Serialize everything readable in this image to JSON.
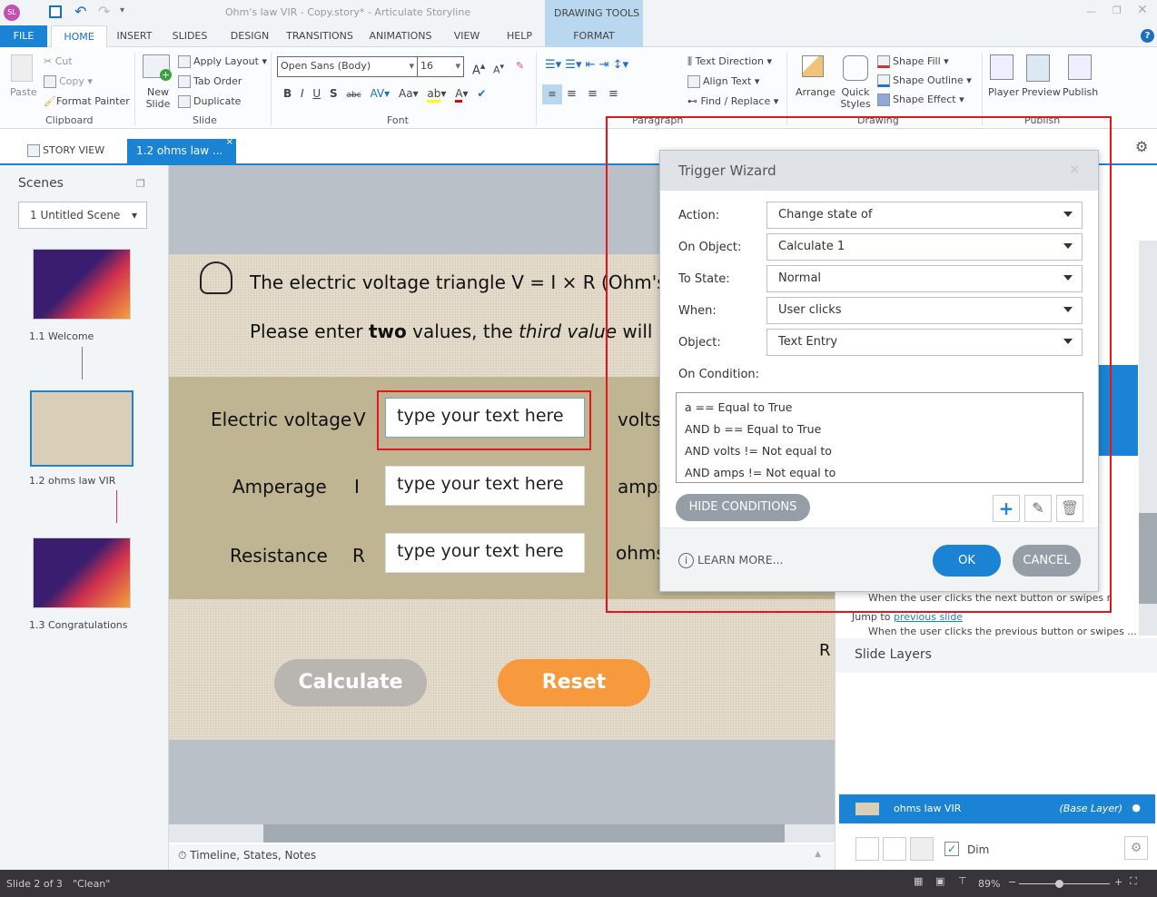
{
  "window": {
    "title": "Ohm's law VIR - Copy.story* -  Articulate Storyline",
    "app_badge": "SL",
    "context_tab_group": "DRAWING TOOLS"
  },
  "ribbon_tabs": [
    "FILE",
    "HOME",
    "INSERT",
    "SLIDES",
    "DESIGN",
    "TRANSITIONS",
    "ANIMATIONS",
    "VIEW",
    "HELP",
    "FORMAT"
  ],
  "ribbon": {
    "clipboard": {
      "paste": "Paste",
      "cut": "Cut",
      "copy": "Copy",
      "format_painter": "Format Painter",
      "label": "Clipboard"
    },
    "slide": {
      "new_slide": "New Slide",
      "apply_layout": "Apply Layout",
      "tab_order": "Tab Order",
      "duplicate": "Duplicate",
      "label": "Slide"
    },
    "font": {
      "family": "Open Sans (Body)",
      "size": "16",
      "label": "Font"
    },
    "paragraph": {
      "text_direction": "Text Direction",
      "align_text": "Align Text",
      "find_replace": "Find / Replace",
      "label": "Paragraph"
    },
    "drawing": {
      "arrange": "Arrange",
      "quick_styles": "Quick Styles",
      "shape_fill": "Shape Fill",
      "shape_outline": "Shape Outline",
      "shape_effect": "Shape Effect",
      "label": "Drawing"
    },
    "publish": {
      "player": "Player",
      "preview": "Preview",
      "publish": "Publish",
      "label": "Publish"
    }
  },
  "doc_tabs": {
    "story_view": "STORY VIEW",
    "active": "1.2 ohms law ..."
  },
  "scenes": {
    "title": "Scenes",
    "selected_scene": "1 Untitled Scene",
    "slides": [
      {
        "label": "1.1 Welcome"
      },
      {
        "label": "1.2 ohms law VIR"
      },
      {
        "label": "1.3 Congratulations"
      }
    ]
  },
  "slide": {
    "heading": "The electric voltage triangle V = I × R (Ohm's",
    "instr_pre": "Please enter ",
    "instr_bold": "two",
    "instr_mid": " values, the ",
    "instr_italic": "third value",
    "instr_post": " will be",
    "rows": [
      {
        "label": "Electric voltage",
        "symbol": "V",
        "placeholder": "type your text here",
        "unit": "volts"
      },
      {
        "label": "Amperage",
        "symbol": "I",
        "placeholder": "type your text here",
        "unit": "amps"
      },
      {
        "label": "Resistance",
        "symbol": "R",
        "placeholder": "type your text here",
        "unit": "ohms"
      }
    ],
    "stray_r": "R",
    "calculate": "Calculate",
    "reset": "Reset",
    "colors": {
      "calculate": "#b9b5b0",
      "reset": "#f79a3e"
    }
  },
  "timeline_bar": "Timeline, States, Notes",
  "triggers": {
    "line1": "When the user clicks the next button or swipes next",
    "jump_to": "Jump to ",
    "previous_slide": "previous slide",
    "line2": "When the user clicks the previous button or swipes ..."
  },
  "layers": {
    "title": "Slide Layers",
    "base_name": "ohms law VIR",
    "base_tag": "(Base Layer)",
    "dim": "Dim",
    "dim_checked": true
  },
  "status": {
    "slide": "Slide 2 of 3",
    "theme": "\"Clean\"",
    "zoom": "89%",
    "zoom_level_percent": 89
  },
  "dialog": {
    "title": "Trigger Wizard",
    "fields": [
      {
        "label": "Action:",
        "value": "Change state of"
      },
      {
        "label": "On Object:",
        "value": "Calculate 1"
      },
      {
        "label": "To State:",
        "value": "Normal"
      },
      {
        "label": "When:",
        "value": "User clicks"
      },
      {
        "label": "Object:",
        "value": "Text Entry"
      }
    ],
    "on_condition": "On Condition:",
    "conditions": [
      "a == Equal to True",
      "AND b == Equal to True",
      "AND volts != Not equal to",
      "AND amps != Not equal to"
    ],
    "hide_conditions": "HIDE CONDITIONS",
    "learn_more": "LEARN MORE...",
    "ok": "OK",
    "cancel": "CANCEL",
    "colors": {
      "ok": "#1a83d4",
      "cancel": "#959ea6",
      "highlight": "#e8141b"
    }
  }
}
